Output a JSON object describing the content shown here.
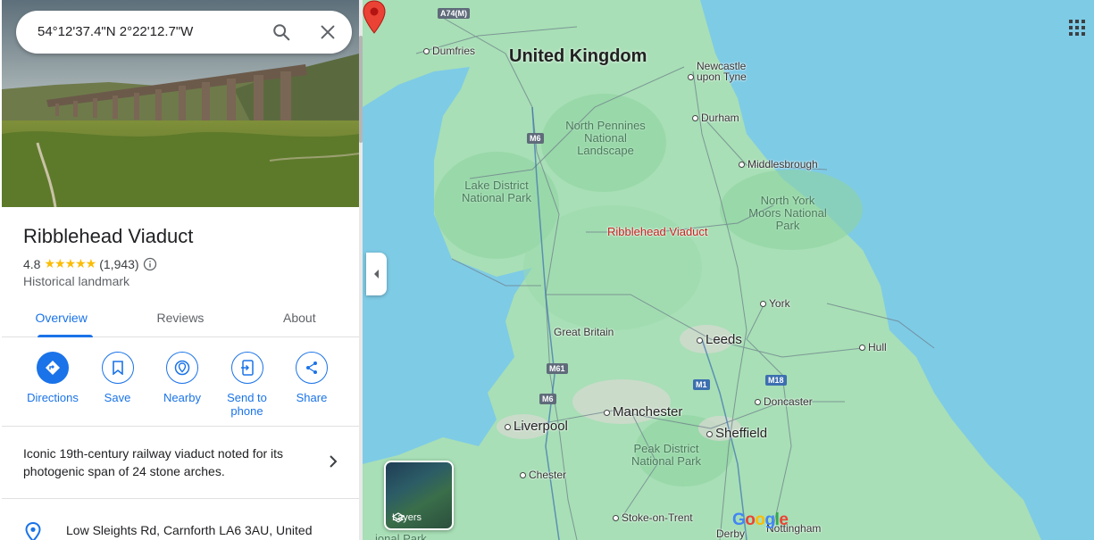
{
  "search": {
    "value": "54°12'37.4\"N 2°22'12.7\"W"
  },
  "place": {
    "title": "Ribblehead Viaduct",
    "rating": "4.8",
    "stars": "★★★★★",
    "review_count": "(1,943)",
    "category": "Historical landmark",
    "description": "Iconic 19th-century railway viaduct noted for its photogenic span of 24 stone arches.",
    "address": "Low Sleights Rd, Carnforth LA6 3AU, United"
  },
  "tabs": [
    {
      "label": "Overview",
      "active": true
    },
    {
      "label": "Reviews",
      "active": false
    },
    {
      "label": "About",
      "active": false
    }
  ],
  "actions": [
    {
      "label": "Directions",
      "icon": "directions-icon"
    },
    {
      "label": "Save",
      "icon": "bookmark-icon"
    },
    {
      "label": "Nearby",
      "icon": "nearby-icon"
    },
    {
      "label": "Send to phone",
      "icon": "send-to-phone-icon"
    },
    {
      "label": "Share",
      "icon": "share-icon"
    }
  ],
  "map": {
    "country": "United Kingdom",
    "pin_label": "Ribblehead Viaduct",
    "layers_label": "Layers",
    "cities": {
      "dumfries": "Dumfries",
      "newcastle": "Newcastle upon Tyne",
      "durham": "Durham",
      "middlesbrough": "Middlesbrough",
      "york": "York",
      "leeds": "Leeds",
      "hull": "Hull",
      "great_britain": "Great Britain",
      "manchester": "Manchester",
      "liverpool": "Liverpool",
      "sheffield": "Sheffield",
      "doncaster": "Doncaster",
      "chester": "Chester",
      "stoke": "Stoke-on-Trent",
      "derby": "Derby",
      "nottingham": "Nottingham"
    },
    "parks": {
      "north_pennines": "North Pennines National Landscape",
      "lake_district": "Lake District National Park",
      "north_york_moors": "North York Moors National Park",
      "peak_district": "Peak District National Park",
      "cut_off": "ional Park"
    },
    "roads": [
      "A74(M)",
      "M6",
      "M6",
      "M61",
      "M1",
      "M18"
    ],
    "logo": "Google",
    "colors": {
      "water": "#7ecbe6",
      "land": "#a8dfb6",
      "park": "#c5e8c9",
      "pin": "#ea4335",
      "accent": "#1a73e8"
    }
  }
}
